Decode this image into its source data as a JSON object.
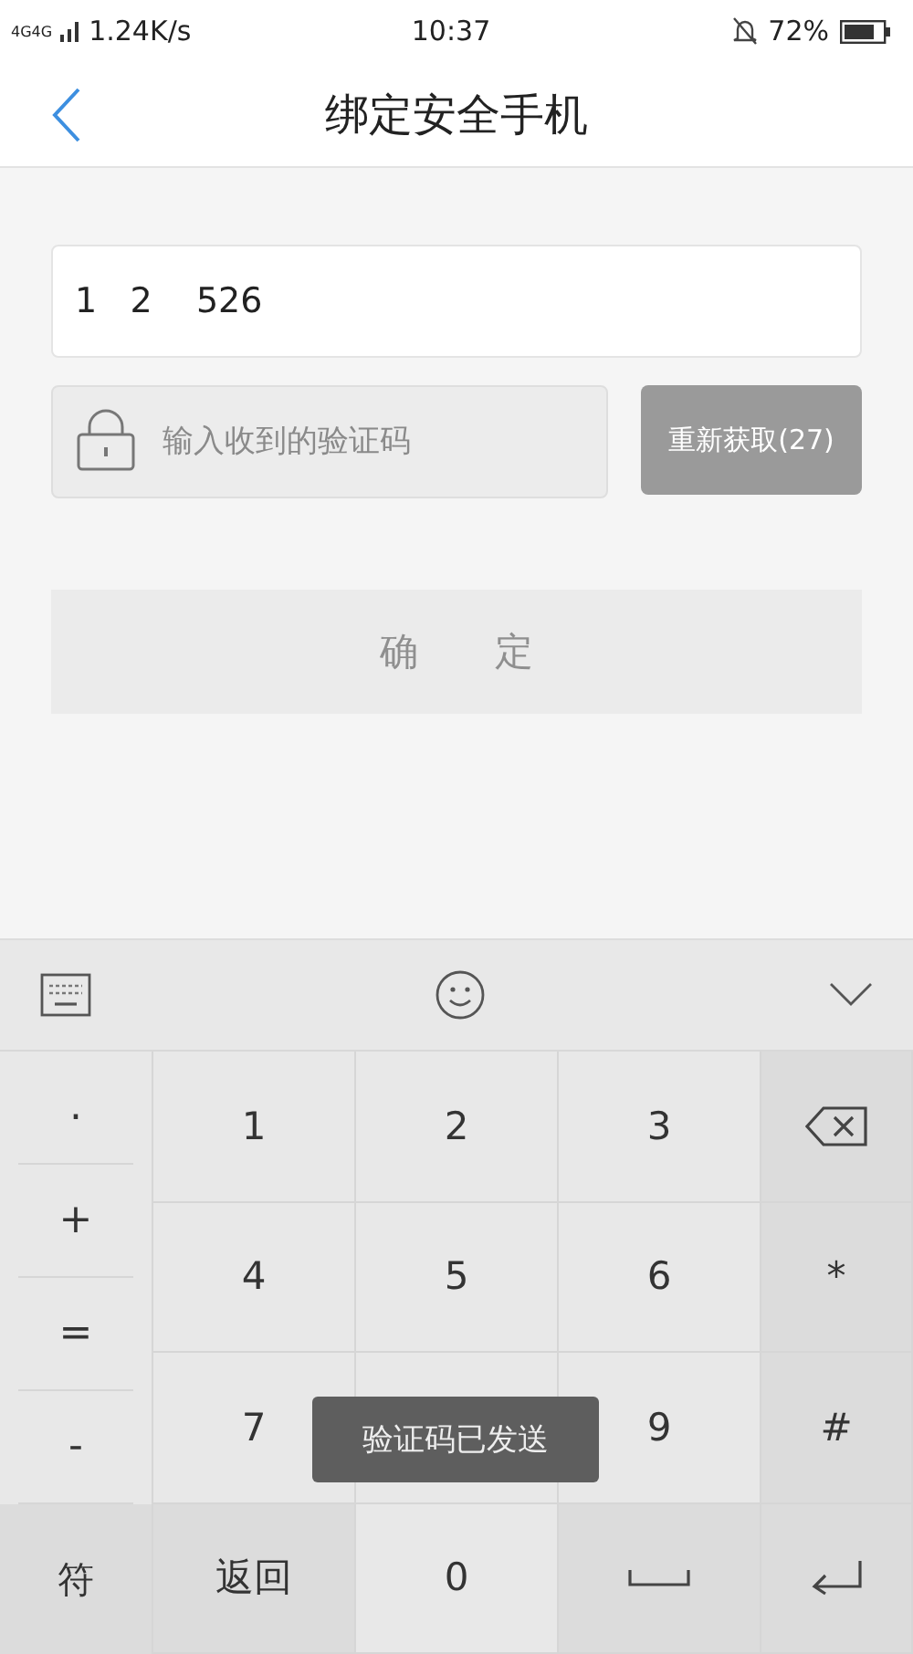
{
  "status_bar": {
    "network": "4G4G",
    "speed": "1.24K/s",
    "time": "10:37",
    "battery": "72%"
  },
  "header": {
    "title": "绑定安全手机"
  },
  "phone_field": {
    "value": "1   2    526"
  },
  "code_field": {
    "placeholder": "输入收到的验证码"
  },
  "resend_button": "重新获取(27)",
  "confirm_button": "确　　定",
  "keyboard": {
    "symbols": [
      ".",
      "+",
      "=",
      "-"
    ],
    "keys": [
      {
        "kind": "digit",
        "label": "1"
      },
      {
        "kind": "digit",
        "label": "2"
      },
      {
        "kind": "digit",
        "label": "3"
      },
      {
        "kind": "backspace"
      },
      {
        "kind": "digit",
        "label": "4"
      },
      {
        "kind": "digit",
        "label": "5"
      },
      {
        "kind": "digit",
        "label": "6"
      },
      {
        "kind": "symbol",
        "label": "*"
      },
      {
        "kind": "digit",
        "label": "7"
      },
      {
        "kind": "digit"
      },
      {
        "kind": "digit",
        "label": "9"
      },
      {
        "kind": "symbol",
        "label": "#"
      },
      {
        "kind": "function",
        "label": "返回"
      },
      {
        "kind": "digit",
        "label": "0"
      },
      {
        "kind": "space"
      },
      {
        "kind": "enter"
      }
    ],
    "symbol_key": "符"
  },
  "toast": "验证码已发送"
}
